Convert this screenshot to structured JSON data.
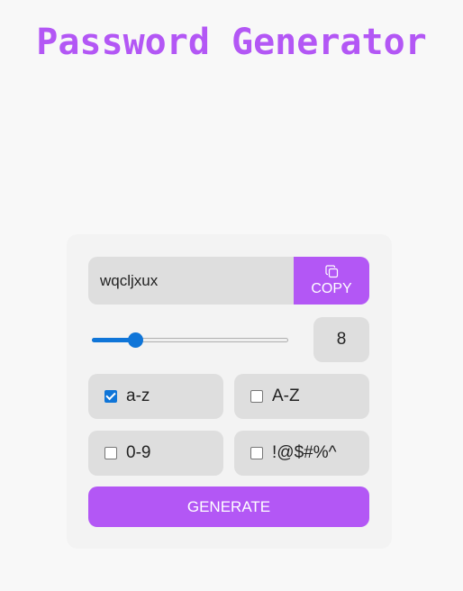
{
  "header": {
    "title": "Password Generator"
  },
  "password": {
    "value": "wqcljxux",
    "copy_label": "COPY",
    "copy_icon": "copy-icon"
  },
  "length": {
    "value": "8",
    "slider_fraction": 0.22
  },
  "options": [
    {
      "label": "a-z",
      "checked": true
    },
    {
      "label": "A-Z",
      "checked": false
    },
    {
      "label": "0-9",
      "checked": false
    },
    {
      "label": "!@$#%^",
      "checked": false
    }
  ],
  "generate": {
    "label": "GENERATE"
  },
  "colors": {
    "accent": "#b357f5",
    "slider": "#0f75d8",
    "field_bg": "#dedede"
  }
}
